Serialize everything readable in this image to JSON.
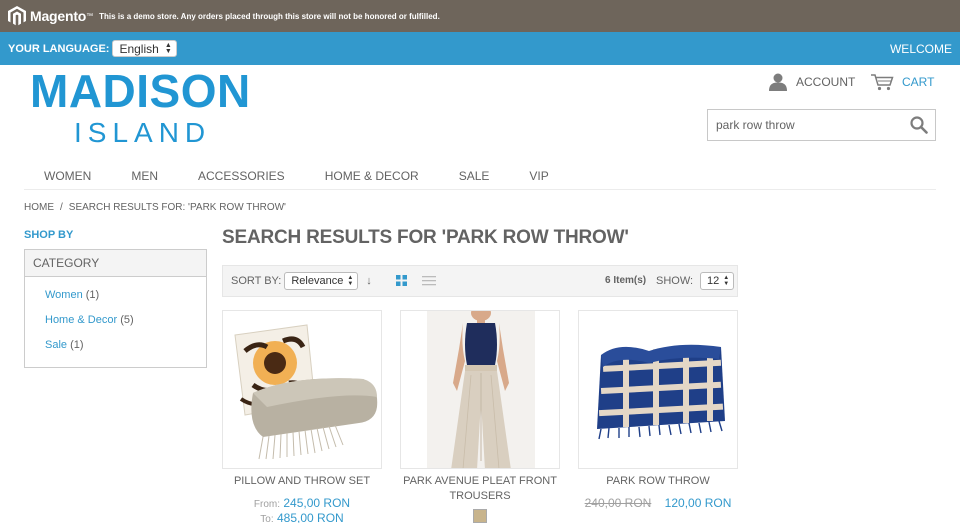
{
  "demo_bar": {
    "brand": "Magento",
    "notice": "This is a demo store. Any orders placed through this store will not be honored or fulfilled."
  },
  "language_bar": {
    "label": "YOUR LANGUAGE:",
    "selected": "English",
    "welcome": "WELCOME"
  },
  "header": {
    "logo_main": "MADISON",
    "logo_sub": "ISLAND",
    "account_label": "ACCOUNT",
    "cart_label": "CART",
    "search_value": "park row throw"
  },
  "nav": {
    "items": [
      "WOMEN",
      "MEN",
      "ACCESSORIES",
      "HOME & DECOR",
      "SALE",
      "VIP"
    ]
  },
  "breadcrumb": {
    "home": "HOME",
    "separator": "/",
    "current": "SEARCH RESULTS FOR: 'PARK ROW THROW'"
  },
  "sidebar": {
    "shop_by": "SHOP BY",
    "category_title": "CATEGORY",
    "categories": [
      {
        "label": "Women",
        "count": "(1)"
      },
      {
        "label": "Home & Decor",
        "count": "(5)"
      },
      {
        "label": "Sale",
        "count": "(1)"
      }
    ]
  },
  "main": {
    "title": "SEARCH RESULTS FOR 'PARK ROW THROW'",
    "toolbar": {
      "sort_label": "SORT BY:",
      "sort_value": "Relevance",
      "sort_dir": "↓",
      "amount": "6 Item(s)",
      "show_label": "SHOW:",
      "show_value": "12"
    },
    "products": [
      {
        "name": "PILLOW AND THROW SET",
        "from_label": "From:",
        "price": "245,00 RON",
        "to_label": "To:",
        "to_price": "485,00 RON"
      },
      {
        "name": "PARK AVENUE PLEAT FRONT TROUSERS",
        "swatch": "#c8b48c"
      },
      {
        "name": "PARK ROW THROW",
        "old_price": "240,00 RON",
        "price": "120,00 RON"
      }
    ]
  },
  "colors": {
    "demo_bar": "#6e655b",
    "accent": "#3399cc",
    "logo": "#2196d3",
    "text": "#636363"
  }
}
